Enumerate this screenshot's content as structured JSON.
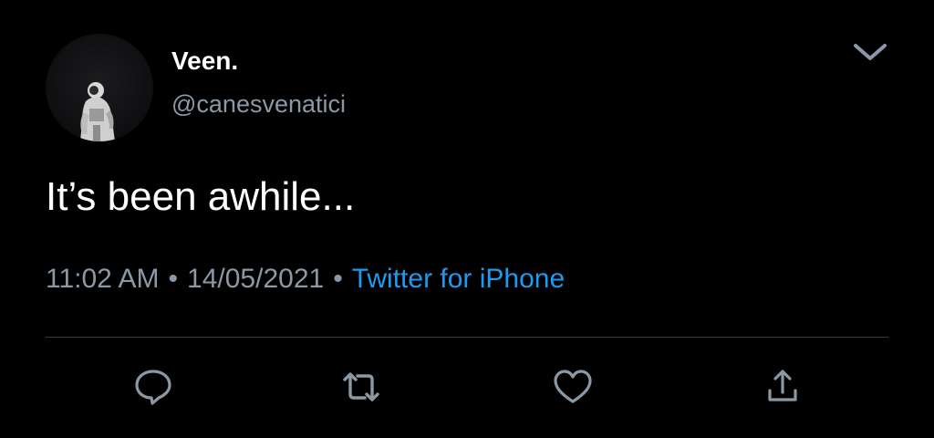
{
  "colors": {
    "background": "#000000",
    "text_primary": "#ffffff",
    "text_secondary": "#8b98a5",
    "link": "#1d9bf0",
    "divider": "#3a3d41"
  },
  "author": {
    "display_name": "Veen.",
    "handle": "@canesvenatici",
    "avatar_icon": "astronaut-avatar"
  },
  "tweet": {
    "text": "It’s been awhile..."
  },
  "meta": {
    "time": "11:02 AM",
    "separator": "•",
    "date": "14/05/2021",
    "source": "Twitter for iPhone"
  },
  "actions": [
    {
      "icon": "reply-icon"
    },
    {
      "icon": "retweet-icon"
    },
    {
      "icon": "like-icon"
    },
    {
      "icon": "share-icon"
    }
  ],
  "menu": {
    "icon": "chevron-down-icon"
  }
}
